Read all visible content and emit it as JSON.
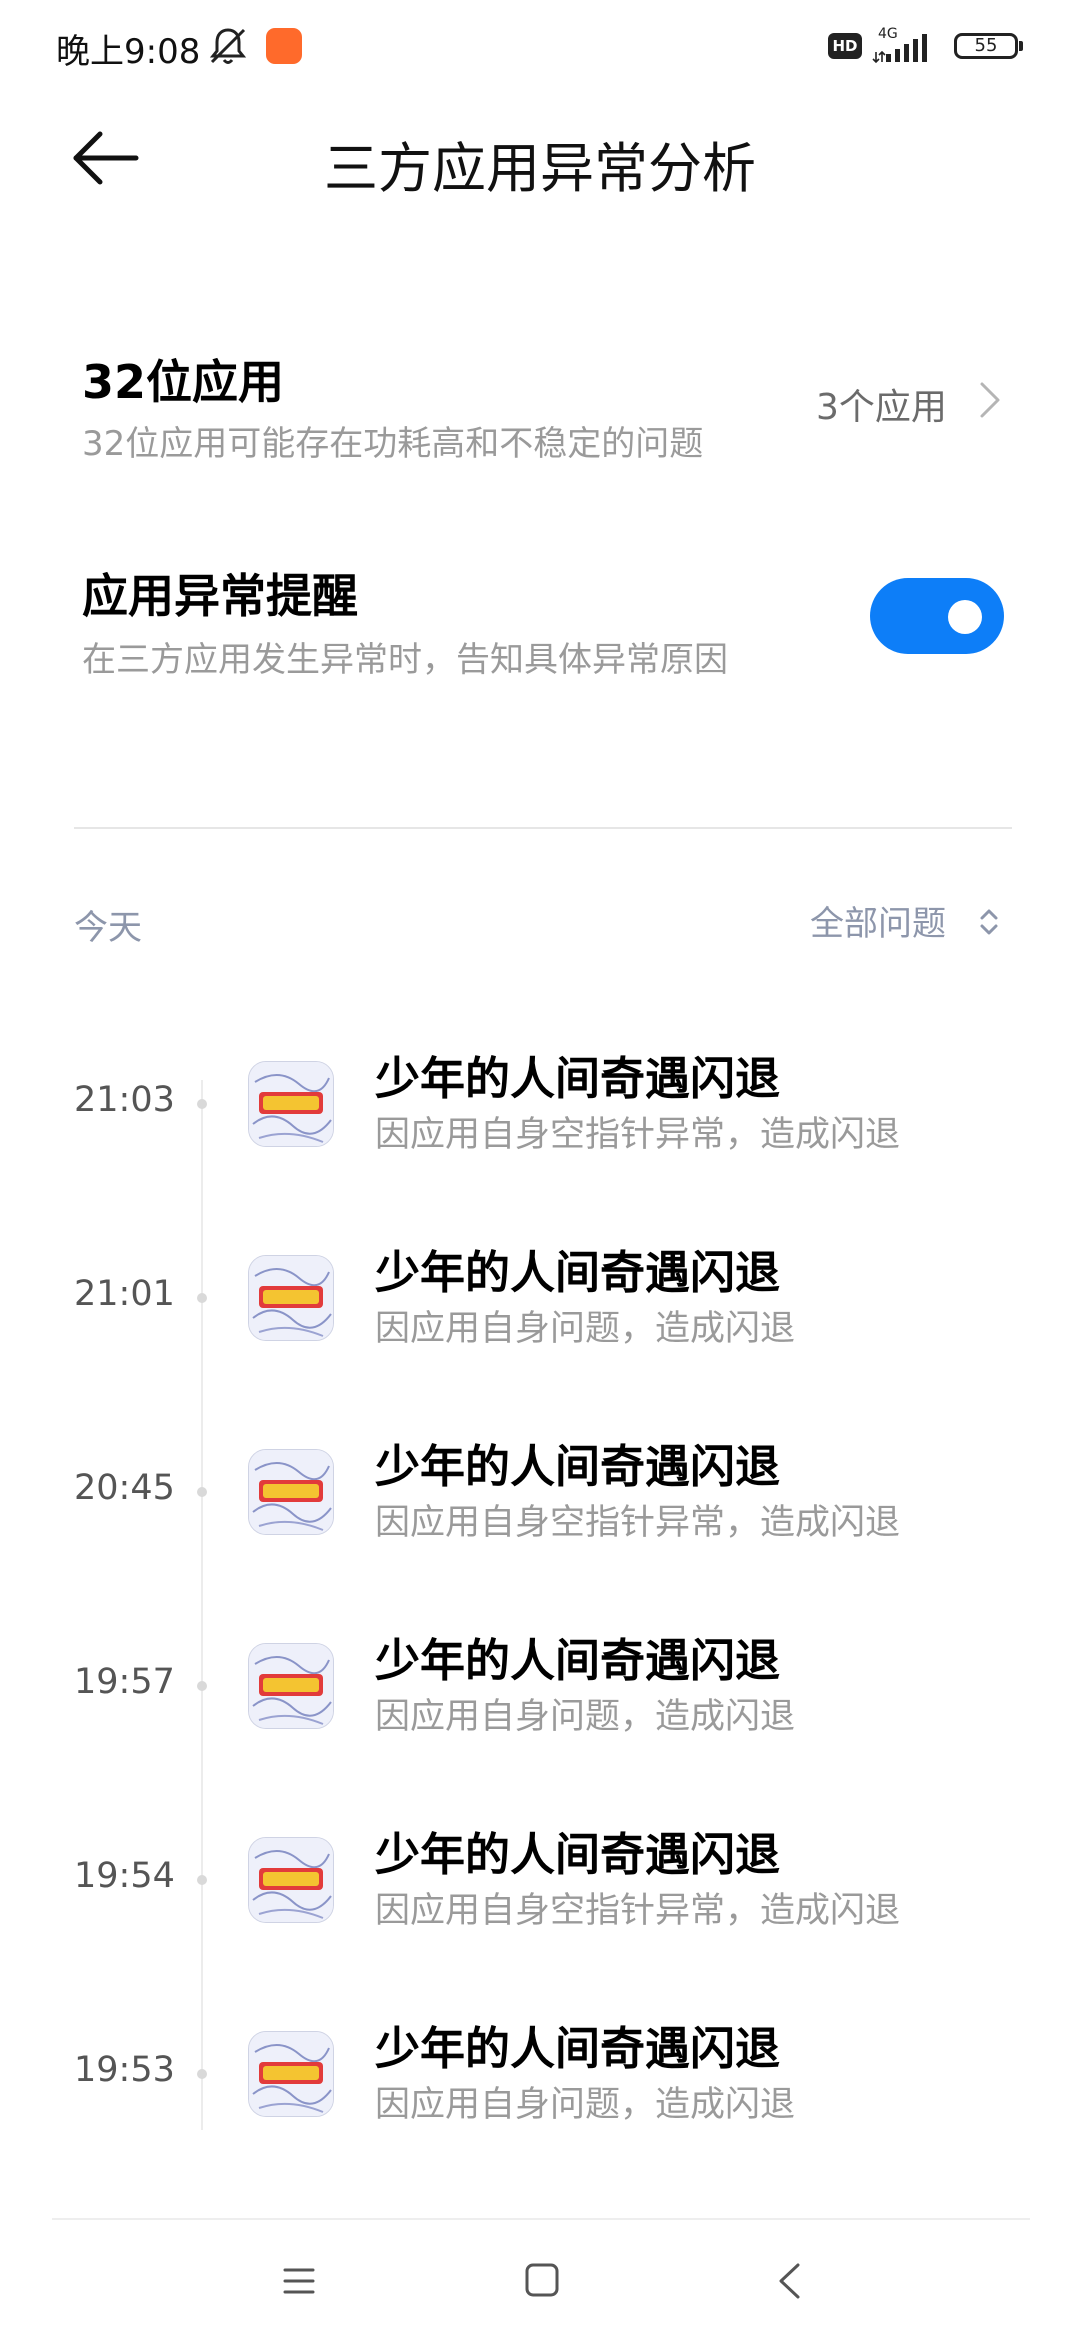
{
  "status_bar": {
    "time": "晚上9:08",
    "hd": "HD",
    "network": "4G",
    "battery": "55"
  },
  "header": {
    "title": "三方应用异常分析"
  },
  "settings": {
    "bit32": {
      "title": "32位应用",
      "subtitle": "32位应用可能存在功耗高和不稳定的问题",
      "value": "3个应用"
    },
    "alert": {
      "title": "应用异常提醒",
      "subtitle": "在三方应用发生异常时，告知具体异常原因",
      "enabled": true
    }
  },
  "list_header": {
    "date_label": "今天",
    "filter_label": "全部问题"
  },
  "events": [
    {
      "time": "21:03",
      "title": "少年的人间奇遇闪退",
      "reason": "因应用自身空指针异常，造成闪退"
    },
    {
      "time": "21:01",
      "title": "少年的人间奇遇闪退",
      "reason": "因应用自身问题，造成闪退"
    },
    {
      "time": "20:45",
      "title": "少年的人间奇遇闪退",
      "reason": "因应用自身空指针异常，造成闪退"
    },
    {
      "time": "19:57",
      "title": "少年的人间奇遇闪退",
      "reason": "因应用自身问题，造成闪退"
    },
    {
      "time": "19:54",
      "title": "少年的人间奇遇闪退",
      "reason": "因应用自身空指针异常，造成闪退"
    },
    {
      "time": "19:53",
      "title": "少年的人间奇遇闪退",
      "reason": "因应用自身问题，造成闪退"
    }
  ],
  "colors": {
    "toggle_on": "#0d7ef8",
    "muted_text": "#9a9a9a",
    "section_text": "#8d96ab"
  },
  "icons": {
    "back": "arrow-left-icon",
    "chevron": "chevron-right-icon",
    "filter": "sort-updown-icon",
    "nav_menu": "menu-lines-icon",
    "nav_home": "square-home-icon",
    "nav_back": "chevron-left-icon"
  }
}
